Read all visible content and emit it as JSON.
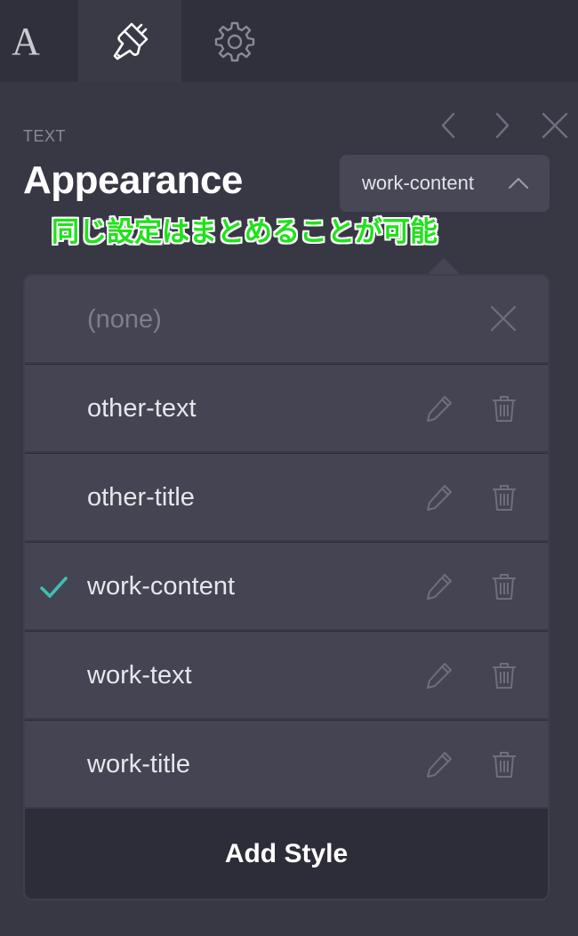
{
  "toolbar": {
    "tabs": [
      {
        "name": "typography",
        "glyph": "A",
        "icon": "typography-icon",
        "active": false
      },
      {
        "name": "style",
        "icon": "paintbrush-icon",
        "active": true
      },
      {
        "name": "settings",
        "icon": "gear-icon",
        "active": false
      }
    ]
  },
  "header": {
    "section_label": "TEXT",
    "title": "Appearance",
    "selected_style": "work-content",
    "nav_icons": [
      "chevron-left-icon",
      "chevron-right-icon",
      "close-icon"
    ]
  },
  "annotation": {
    "text": "同じ設定はまとめることが可能",
    "color": "#1fe21a"
  },
  "dropdown": {
    "options": [
      {
        "label": "(none)",
        "selected": false,
        "type": "none"
      },
      {
        "label": "other-text",
        "selected": false,
        "type": "style"
      },
      {
        "label": "other-title",
        "selected": false,
        "type": "style"
      },
      {
        "label": "work-content",
        "selected": true,
        "type": "style"
      },
      {
        "label": "work-text",
        "selected": false,
        "type": "style"
      },
      {
        "label": "work-title",
        "selected": false,
        "type": "style"
      }
    ],
    "add_label": "Add Style"
  },
  "colors": {
    "background": "#383845",
    "toolbar": "#30303c",
    "option": "#444452",
    "check": "#3fbfb0",
    "icon_muted": "#6e6e7c"
  }
}
